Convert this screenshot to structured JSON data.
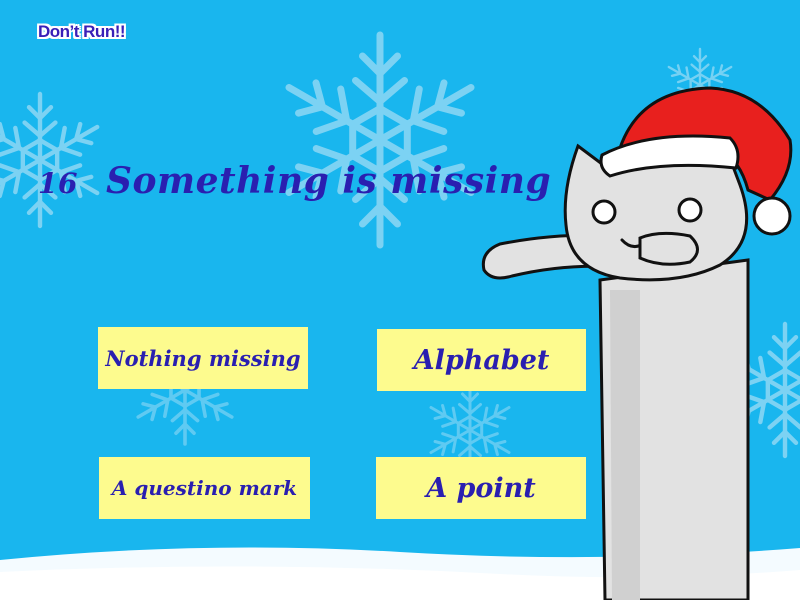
{
  "top_button": {
    "label": "Don’t Run!!"
  },
  "question": {
    "number": "16",
    "text": "Something is missing"
  },
  "answers": [
    {
      "label": "Nothing missing"
    },
    {
      "label": "Alphabet"
    },
    {
      "label": "A questino mark"
    },
    {
      "label": "A point"
    }
  ],
  "colors": {
    "sky": "#19b6ee",
    "answer_box": "#fdfb8e",
    "text": "#2a1fb0",
    "snow": "#ffffff",
    "hat": "#e8201e"
  },
  "decor": {
    "background": "snowflakes-and-snow-ground",
    "character": "longcat-with-santa-hat"
  }
}
